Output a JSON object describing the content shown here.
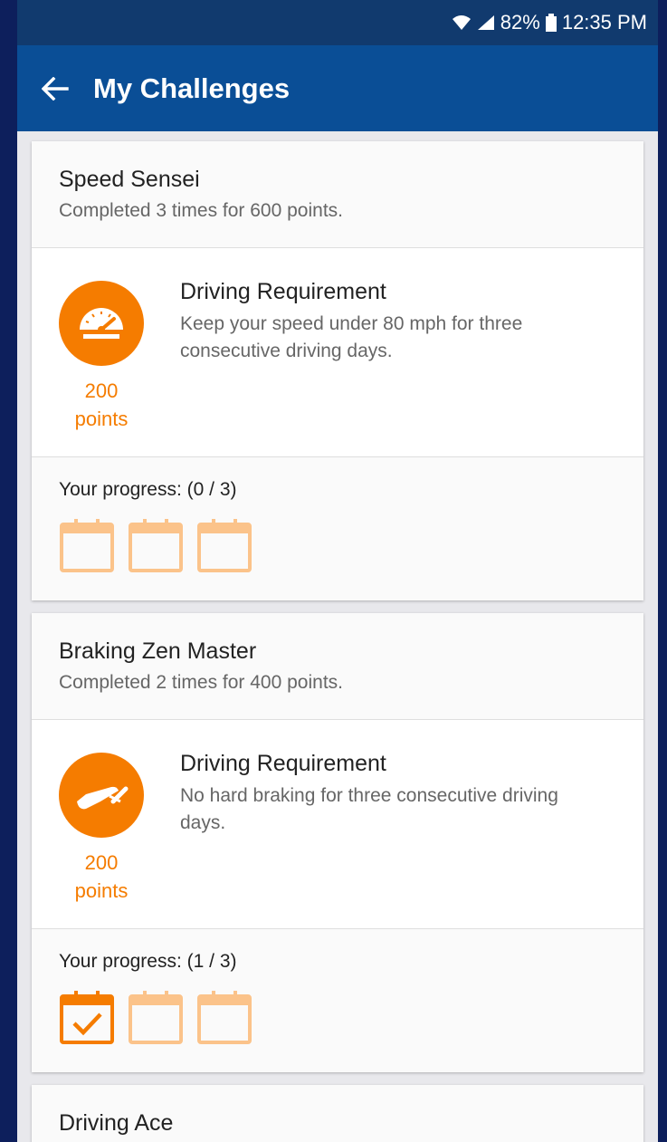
{
  "status": {
    "battery": "82%",
    "time": "12:35 PM",
    "wifi_icon": "wifi-icon",
    "signal_icon": "signal-icon",
    "battery_icon": "battery-icon"
  },
  "header": {
    "title": "My Challenges",
    "back_icon": "back-arrow-icon"
  },
  "colors": {
    "accent": "#f57c00",
    "appbar": "#0a4e96",
    "statusbar": "#113a6e"
  },
  "challenges": [
    {
      "name": "Speed Sensei",
      "completed": "Completed 3 times for 600 points.",
      "icon": "speedometer-icon",
      "points_value": "200",
      "points_unit": "points",
      "req_title": "Driving Requirement",
      "req_desc": "Keep your speed under 80 mph for three consecutive driving days.",
      "progress_label": "Your progress: (0 / 3)",
      "progress": [
        false,
        false,
        false
      ]
    },
    {
      "name": "Braking Zen Master",
      "completed": "Completed 2 times for 400 points.",
      "icon": "brake-pedal-icon",
      "points_value": "200",
      "points_unit": "points",
      "req_title": "Driving Requirement",
      "req_desc": "No hard braking for three consecutive driving days.",
      "progress_label": "Your progress: (1 / 3)",
      "progress": [
        true,
        false,
        false
      ]
    },
    {
      "name": "Driving Ace"
    }
  ]
}
